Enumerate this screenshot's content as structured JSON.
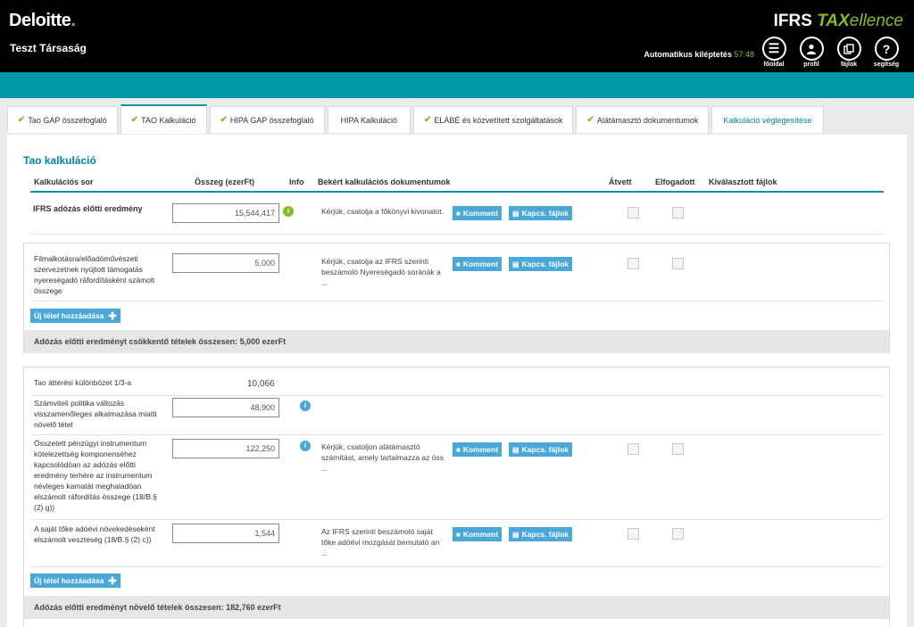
{
  "header": {
    "logo_text": "Deloitte",
    "logo_dot": ".",
    "company": "Teszt Társaság",
    "product_prefix": "IFRS ",
    "product_tax": "TAX",
    "product_suffix": "ellence",
    "autologout_label": "Automatikus kiléptetés",
    "autologout_time": "57:48",
    "nav": [
      {
        "label": "főoldal",
        "icon": "menu-icon"
      },
      {
        "label": "profil",
        "icon": "user-icon"
      },
      {
        "label": "fájlok",
        "icon": "files-icon"
      },
      {
        "label": "segítség",
        "icon": "help-icon"
      }
    ]
  },
  "tabs": [
    {
      "label": "Tao GAP összefoglaló",
      "checked": true
    },
    {
      "label": "TAO Kalkuláció",
      "checked": true,
      "active": true
    },
    {
      "label": "HIPA GAP összefoglaló",
      "checked": true
    },
    {
      "label": "HIPA Kalkuláció",
      "checked": false
    },
    {
      "label": "ELÁBÉ és közvetített szolgáltatások",
      "checked": true
    },
    {
      "label": "Alátámasztó dokumentumok",
      "checked": true
    },
    {
      "label": "Kalkuláció véglegesítése",
      "checked": false
    }
  ],
  "main": {
    "title": "Tao kalkuláció",
    "columns": {
      "row": "Kalkulációs sor",
      "amount": "Összeg (ezerFt)",
      "info": "Info",
      "docs": "Bekért kalkulációs dokumentumok",
      "taken": "Átvett",
      "accepted": "Elfogadott",
      "files": "Kiválasztott fájlok"
    },
    "comment_label": "Komment",
    "files_label": "Kapcs. fájlok",
    "add_label": "Új tétel hozzáadása",
    "row_ifrs": {
      "label": "IFRS adózás előtti eredmény",
      "value": "15,544,417",
      "doc": "Kérjük, csatolja a főkönyvi kivonatot."
    },
    "section1": {
      "row": {
        "label": "Filmalkotásra/előadóművészeti szervezetnek nyújtott támogatás nyereségadó ráfordításként számolt összege",
        "value": "5,000",
        "doc": "Kérjük, csatolja az IFRS szerinti beszámoló Nyereségadó soránák a ..."
      },
      "sum": "Adózás előtti eredményt csökkentő tételek összesen: 5,000 ezerFt"
    },
    "section2": {
      "row_a": {
        "label": "Tao áttérési különbözet 1/3-a",
        "value": "10,066"
      },
      "row_b": {
        "label": "Számviteli politika változás visszamenőleges alkalmazása miatti növelő tétel",
        "value": "48,900"
      },
      "row_c": {
        "label": "Összetett pénzügyi instrumentum kötelezettség komponenséhez kapcsolódóan az adózás előtti eredmény terhére az instrumentum névleges kamatát meghaladóan elszámolt ráfordítás összege (18/B.§ (2) g))",
        "value": "122,250",
        "doc": "Kérjük, csatoljon alátámasztó számítást, amely tartalmazza az öss ..."
      },
      "row_d": {
        "label": "A saját tőke adóévi növekedéseként elszámolt veszteség (18/B.§ (2) c))",
        "value": "1,544",
        "doc": "Az IFRS szerinti beszámoló saját tőke adóévi mozgását bemutató an ..."
      },
      "sum": "Adózás előtti eredményt növelő tételek összesen: 182,760 ezerFt"
    }
  }
}
